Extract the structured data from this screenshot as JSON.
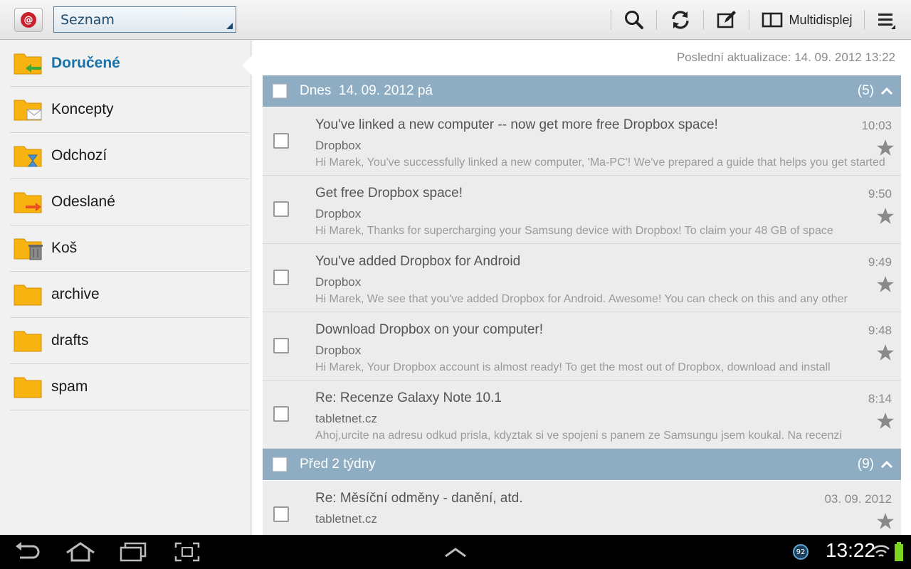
{
  "actionbar": {
    "account": "Seznam",
    "multidisplay_label": "Multidisplej"
  },
  "sidebar": {
    "folders": [
      {
        "name": "Doručené",
        "icon": "inbox-folder-icon",
        "active": true
      },
      {
        "name": "Koncepty",
        "icon": "drafts-folder-icon"
      },
      {
        "name": "Odchozí",
        "icon": "outbox-folder-icon"
      },
      {
        "name": "Odeslané",
        "icon": "sent-folder-icon"
      },
      {
        "name": "Koš",
        "icon": "trash-folder-icon"
      },
      {
        "name": "archive",
        "icon": "folder-icon"
      },
      {
        "name": "drafts",
        "icon": "folder-icon"
      },
      {
        "name": "spam",
        "icon": "folder-icon"
      }
    ]
  },
  "content": {
    "last_update_label": "Poslední aktualizace:",
    "last_update_value": "14. 09. 2012 13:22",
    "groups": [
      {
        "title": "Dnes  14. 09. 2012 pá",
        "count": "(5)",
        "mails": [
          {
            "subject": "You've linked a new computer -- now get more free Dropbox space!",
            "sender": "Dropbox",
            "preview": "Hi Marek, You've successfully linked a new computer, 'Ma-PC'! We've prepared a guide that helps you get started",
            "time": "10:03"
          },
          {
            "subject": "Get free Dropbox space!",
            "sender": "Dropbox",
            "preview": "Hi Marek, Thanks for supercharging your Samsung device with Dropbox! To claim your 48 GB of space",
            "time": "9:50"
          },
          {
            "subject": "You've added Dropbox for Android",
            "sender": "Dropbox",
            "preview": "Hi Marek, We see that you've added Dropbox for Android. Awesome! You can check on this and any other",
            "time": "9:49"
          },
          {
            "subject": "Download Dropbox on your computer!",
            "sender": "Dropbox",
            "preview": "Hi Marek, Your Dropbox account is almost ready! To get the most out of Dropbox, download and install",
            "time": "9:48"
          },
          {
            "subject": "Re: Recenze Galaxy Note 10.1",
            "sender": "tabletnet.cz",
            "preview": "Ahoj,urcite na adresu odkud prisla, kdyztak si ve spojeni s panem ze Samsungu jsem koukal. Na recenzi",
            "time": "8:14"
          }
        ]
      },
      {
        "title": "Před 2 týdny",
        "count": "(9)",
        "mails": [
          {
            "subject": "Re: Měsíční odměny - danění, atd.",
            "sender": "tabletnet.cz",
            "preview": "",
            "time": "03. 09. 2012"
          }
        ]
      }
    ]
  },
  "sysbar": {
    "clock": "13:22",
    "notification_badge": "92"
  },
  "colors": {
    "group_header": "#8eadc3",
    "active_folder": "#1a73a8",
    "folder_yellow": "#f7b30f"
  }
}
